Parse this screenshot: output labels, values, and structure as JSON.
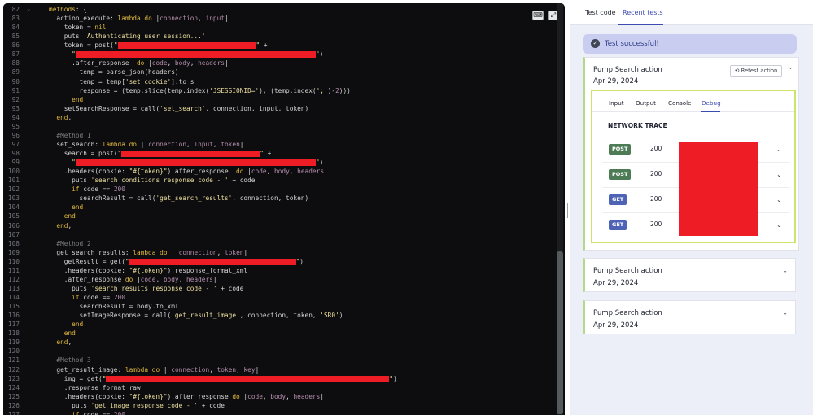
{
  "editor": {
    "buttons": {
      "keyboard_icon": "⌨",
      "expand_icon": "⤢"
    },
    "lines": [
      {
        "n": "82",
        "fold": true,
        "parts": [
          [
            "k",
            "methods"
          ],
          [
            "p",
            ": {"
          ]
        ]
      },
      {
        "n": "83",
        "parts": [
          [
            "p",
            "  action_execute: "
          ],
          [
            "k",
            "lambda"
          ],
          [
            "p",
            " "
          ],
          [
            "k",
            "do"
          ],
          [
            "p",
            " |"
          ],
          [
            "n",
            "connection"
          ],
          [
            "p",
            ", "
          ],
          [
            "n",
            "input"
          ],
          [
            "p",
            "|"
          ]
        ]
      },
      {
        "n": "84",
        "parts": [
          [
            "p",
            "    token = "
          ],
          [
            "k",
            "nil"
          ]
        ]
      },
      {
        "n": "85",
        "parts": [
          [
            "p",
            "    puts "
          ],
          [
            "s",
            "'Authenticating user session...'"
          ]
        ]
      },
      {
        "n": "86",
        "parts": [
          [
            "p",
            "    token = post("
          ],
          [
            "s",
            "\""
          ],
          [
            "r",
            170
          ],
          [
            "s",
            "\""
          ],
          [
            "p",
            " +"
          ]
        ]
      },
      {
        "n": "87",
        "parts": [
          [
            "p",
            "      "
          ],
          [
            "s",
            "\""
          ],
          [
            "r",
            295
          ],
          [
            "s",
            "\""
          ],
          [
            "p",
            ")"
          ]
        ]
      },
      {
        "n": "88",
        "parts": [
          [
            "p",
            "      .after_response  "
          ],
          [
            "k",
            "do"
          ],
          [
            "p",
            " |"
          ],
          [
            "n",
            "code"
          ],
          [
            "p",
            ", "
          ],
          [
            "n",
            "body"
          ],
          [
            "p",
            ", "
          ],
          [
            "n",
            "headers"
          ],
          [
            "p",
            "|"
          ]
        ]
      },
      {
        "n": "89",
        "parts": [
          [
            "p",
            "        temp = parse_json(headers)"
          ]
        ]
      },
      {
        "n": "90",
        "parts": [
          [
            "p",
            "        temp = temp["
          ],
          [
            "s",
            "'set_cookie'"
          ],
          [
            "p",
            "].to_s"
          ]
        ]
      },
      {
        "n": "91",
        "parts": [
          [
            "p",
            "        response = (temp.slice(temp.index("
          ],
          [
            "s",
            "'JSESSIONID='"
          ],
          [
            "p",
            "), (temp.index("
          ],
          [
            "s",
            "';'"
          ],
          [
            "p",
            ")-"
          ],
          [
            "n",
            "2"
          ],
          [
            "p",
            ")))"
          ]
        ]
      },
      {
        "n": "92",
        "parts": [
          [
            "k",
            "      end"
          ]
        ]
      },
      {
        "n": "93",
        "parts": [
          [
            "p",
            "    setSearchResponse = call("
          ],
          [
            "s",
            "'set_search'"
          ],
          [
            "p",
            ", connection, input, token)"
          ]
        ]
      },
      {
        "n": "94",
        "parts": [
          [
            "k",
            "  end"
          ],
          [
            "p",
            ","
          ]
        ]
      },
      {
        "n": "95",
        "parts": []
      },
      {
        "n": "96",
        "parts": [
          [
            "c",
            "  #Method 1"
          ]
        ]
      },
      {
        "n": "97",
        "parts": [
          [
            "p",
            "  set_search: "
          ],
          [
            "k",
            "lambda"
          ],
          [
            "p",
            " "
          ],
          [
            "k",
            "do"
          ],
          [
            "p",
            " | "
          ],
          [
            "n",
            "connection"
          ],
          [
            "p",
            ", "
          ],
          [
            "n",
            "input"
          ],
          [
            "p",
            ", "
          ],
          [
            "n",
            "token"
          ],
          [
            "p",
            "|"
          ]
        ]
      },
      {
        "n": "98",
        "parts": [
          [
            "p",
            "    search = post("
          ],
          [
            "s",
            "\""
          ],
          [
            "r",
            170
          ],
          [
            "s",
            "\""
          ],
          [
            "p",
            " +"
          ]
        ]
      },
      {
        "n": "99",
        "parts": [
          [
            "p",
            "      "
          ],
          [
            "s",
            "\""
          ],
          [
            "r",
            295
          ],
          [
            "s",
            "\""
          ],
          [
            "p",
            ")"
          ]
        ]
      },
      {
        "n": "100",
        "parts": [
          [
            "p",
            "    .headers(cookie: "
          ],
          [
            "s",
            "\"#{token}\""
          ],
          [
            "p",
            ").after_response  "
          ],
          [
            "k",
            "do"
          ],
          [
            "p",
            " |"
          ],
          [
            "n",
            "code"
          ],
          [
            "p",
            ", "
          ],
          [
            "n",
            "body"
          ],
          [
            "p",
            ", "
          ],
          [
            "n",
            "headers"
          ],
          [
            "p",
            "|"
          ]
        ]
      },
      {
        "n": "101",
        "parts": [
          [
            "p",
            "      puts "
          ],
          [
            "s",
            "'search conditions response code - '"
          ],
          [
            "p",
            " + code"
          ]
        ]
      },
      {
        "n": "102",
        "parts": [
          [
            "k",
            "      if"
          ],
          [
            "p",
            " code == "
          ],
          [
            "n",
            "200"
          ]
        ]
      },
      {
        "n": "103",
        "parts": [
          [
            "p",
            "        searchResult = call("
          ],
          [
            "s",
            "'get_search_results'"
          ],
          [
            "p",
            ", connection, token)"
          ]
        ]
      },
      {
        "n": "104",
        "parts": [
          [
            "k",
            "      end"
          ]
        ]
      },
      {
        "n": "105",
        "parts": [
          [
            "k",
            "    end"
          ]
        ]
      },
      {
        "n": "106",
        "parts": [
          [
            "k",
            "  end"
          ],
          [
            "p",
            ","
          ]
        ]
      },
      {
        "n": "107",
        "parts": []
      },
      {
        "n": "108",
        "parts": [
          [
            "c",
            "  #Method 2"
          ]
        ]
      },
      {
        "n": "109",
        "parts": [
          [
            "p",
            "  get_search_results: "
          ],
          [
            "k",
            "lambda"
          ],
          [
            "p",
            " "
          ],
          [
            "k",
            "do"
          ],
          [
            "p",
            " | "
          ],
          [
            "n",
            "connection"
          ],
          [
            "p",
            ", "
          ],
          [
            "n",
            "token"
          ],
          [
            "p",
            "|"
          ]
        ]
      },
      {
        "n": "110",
        "parts": [
          [
            "p",
            "    getResult = get("
          ],
          [
            "s",
            "\""
          ],
          [
            "r",
            205
          ],
          [
            "s",
            "\""
          ],
          [
            "p",
            ")"
          ]
        ]
      },
      {
        "n": "111",
        "parts": [
          [
            "p",
            "    .headers(cookie: "
          ],
          [
            "s",
            "\"#{token}\""
          ],
          [
            "p",
            ").response_format_xml"
          ]
        ]
      },
      {
        "n": "112",
        "parts": [
          [
            "p",
            "    .after_response "
          ],
          [
            "k",
            "do"
          ],
          [
            "p",
            " |"
          ],
          [
            "n",
            "code"
          ],
          [
            "p",
            ", "
          ],
          [
            "n",
            "body"
          ],
          [
            "p",
            ", "
          ],
          [
            "n",
            "headers"
          ],
          [
            "p",
            "|"
          ]
        ]
      },
      {
        "n": "113",
        "parts": [
          [
            "p",
            "      puts "
          ],
          [
            "s",
            "'search results response code - '"
          ],
          [
            "p",
            " + code"
          ]
        ]
      },
      {
        "n": "114",
        "parts": [
          [
            "k",
            "      if"
          ],
          [
            "p",
            " code == "
          ],
          [
            "n",
            "200"
          ]
        ]
      },
      {
        "n": "115",
        "parts": [
          [
            "p",
            "        searchResult = body.to_xml"
          ]
        ]
      },
      {
        "n": "116",
        "parts": [
          [
            "p",
            "        setImageResponse = call("
          ],
          [
            "s",
            "'get_result_image'"
          ],
          [
            "p",
            ", connection, token, "
          ],
          [
            "s",
            "'SR0'"
          ],
          [
            "p",
            ")"
          ]
        ]
      },
      {
        "n": "117",
        "parts": [
          [
            "k",
            "      end"
          ]
        ]
      },
      {
        "n": "118",
        "parts": [
          [
            "k",
            "    end"
          ]
        ]
      },
      {
        "n": "119",
        "parts": [
          [
            "k",
            "  end"
          ],
          [
            "p",
            ","
          ]
        ]
      },
      {
        "n": "120",
        "parts": []
      },
      {
        "n": "121",
        "parts": [
          [
            "c",
            "  #Method 3"
          ]
        ]
      },
      {
        "n": "122",
        "parts": [
          [
            "p",
            "  get_result_image: "
          ],
          [
            "k",
            "lambda"
          ],
          [
            "p",
            " "
          ],
          [
            "k",
            "do"
          ],
          [
            "p",
            " | "
          ],
          [
            "n",
            "connection"
          ],
          [
            "p",
            ", "
          ],
          [
            "n",
            "token"
          ],
          [
            "p",
            ", "
          ],
          [
            "n",
            "key"
          ],
          [
            "p",
            "|"
          ]
        ]
      },
      {
        "n": "123",
        "parts": [
          [
            "p",
            "    img = get("
          ],
          [
            "s",
            "\""
          ],
          [
            "r",
            348
          ],
          [
            "s",
            "\""
          ],
          [
            "p",
            ")"
          ]
        ]
      },
      {
        "n": "124",
        "parts": [
          [
            "p",
            "    .response_format_raw"
          ]
        ]
      },
      {
        "n": "125",
        "parts": [
          [
            "p",
            "    .headers(cookie: "
          ],
          [
            "s",
            "\"#{token}\""
          ],
          [
            "p",
            ").after_response "
          ],
          [
            "k",
            "do"
          ],
          [
            "p",
            " |"
          ],
          [
            "n",
            "code"
          ],
          [
            "p",
            ", "
          ],
          [
            "n",
            "body"
          ],
          [
            "p",
            ", "
          ],
          [
            "n",
            "headers"
          ],
          [
            "p",
            "|"
          ]
        ]
      },
      {
        "n": "126",
        "parts": [
          [
            "p",
            "      puts "
          ],
          [
            "s",
            "'get image response code - '"
          ],
          [
            "p",
            " + code"
          ]
        ]
      },
      {
        "n": "127",
        "parts": [
          [
            "k",
            "      if"
          ],
          [
            "p",
            " code == "
          ],
          [
            "n",
            "200"
          ]
        ]
      }
    ]
  },
  "panel": {
    "tabs": [
      {
        "label": "Test code"
      },
      {
        "label": "Recent tests",
        "active": true
      }
    ],
    "banner": {
      "text": "Test successful!",
      "icon": "check-icon"
    },
    "cards": [
      {
        "title": "Pump Search action",
        "date": "Apr 29, 2024",
        "retest_label": "Retest action",
        "expanded": true,
        "debug": {
          "tabs": [
            {
              "label": "Input"
            },
            {
              "label": "Output"
            },
            {
              "label": "Console"
            },
            {
              "label": "Debug",
              "active": true
            }
          ],
          "trace_title": "NETWORK TRACE",
          "requests": [
            {
              "method": "POST",
              "status": "200"
            },
            {
              "method": "POST",
              "status": "200"
            },
            {
              "method": "GET",
              "status": "200"
            },
            {
              "method": "GET",
              "status": "200"
            }
          ]
        }
      },
      {
        "title": "Pump Search action",
        "date": "Apr 29, 2024"
      },
      {
        "title": "Pump Search action",
        "date": "Apr 29, 2024"
      }
    ]
  },
  "colors": {
    "accent": "#3d4bb0",
    "redaction": "#ee1c25",
    "highlight": "#cde46a",
    "post": "#4c7b56",
    "get": "#4f63b6"
  }
}
